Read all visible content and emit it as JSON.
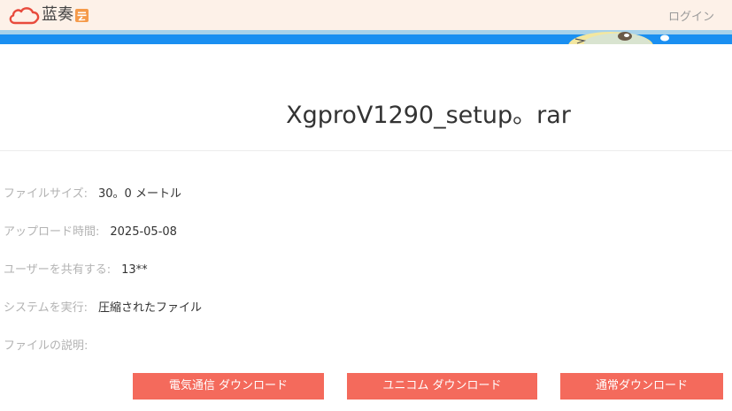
{
  "header": {
    "logo_text": "蓝奏",
    "logo_badge_icon": "cloud-badge-icon",
    "login_label": "ログイン",
    "background_color": "#fdf1e8"
  },
  "banner": {
    "color": "#1a8ff1"
  },
  "file": {
    "title": "XgproV1290_setup。rar"
  },
  "info": {
    "size_label": "ファイルサイズ:",
    "size_value": "30。0 メートル",
    "upload_label": "アップロード時間:",
    "upload_value": "2025-05-08",
    "share_label": "ユーザーを共有する:",
    "share_value": "13**",
    "system_label": "システムを実行:",
    "system_value": "圧縮されたファイル",
    "description_label": "ファイルの説明:"
  },
  "downloads": {
    "telecom_label": "電気通信 ダウンロード",
    "unicom_label": "ユニコム ダウンロード",
    "normal_label": "通常ダウンロード",
    "button_color": "#f46a5c"
  }
}
